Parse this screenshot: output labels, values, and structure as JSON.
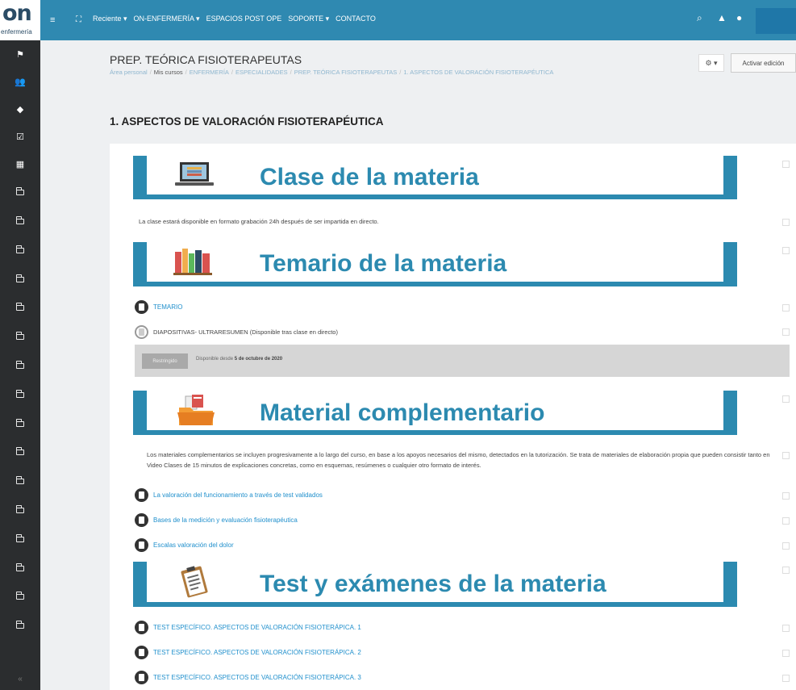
{
  "logo": {
    "text": "on",
    "subtext": "enfermería"
  },
  "topnav": {
    "items": [
      "Reciente ▾",
      "ON-ENFERMERÍA ▾",
      "ESPACIOS POST OPE",
      "SOPORTE ▾",
      "CONTACTO"
    ]
  },
  "header": {
    "course_title": "PREP. TEÓRICA FISIOTERAPEUTAS",
    "breadcrumb": [
      "Área personal",
      "Mis cursos",
      "ENFERMERÍA",
      "ESPECIALIDADES",
      "PREP. TEÓRICA FISIOTERAPEUTAS",
      "1. ASPECTOS DE VALORACIÓN FISIOTERAPÉUTICA"
    ],
    "edit_button": "Activar edición",
    "gear_label": "⚙ ▾"
  },
  "section": {
    "title": "1. ASPECTOS DE VALORACIÓN FISIOTERAPÉUTICA"
  },
  "banners": {
    "clase": "Clase de la materia",
    "temario": "Temario de la materia",
    "material": "Material complementario",
    "test": "Test y exámenes de la materia"
  },
  "clase_note": "La clase estará disponible en formato grabación 24h después de ser impartida en directo.",
  "temario_items": {
    "temario": "TEMARIO",
    "diapositivas": "DIAPOSITIVAS- ULTRARESUMEN (Disponible tras clase en directo)"
  },
  "restriction": {
    "badge": "Restringido",
    "text_prefix": "Disponible desde ",
    "date": "5 de octubre de 2020"
  },
  "material_note": "Los materiales complementarios se incluyen progresivamente a lo largo del curso, en base a los apoyos necesarios del mismo, detectados en la tutorización. Se trata de materiales de elaboración propia que pueden consistir tanto en Video Clases de 15 minutos de explicaciones concretas, como en esquemas, resúmenes o cualquier otro formato de interés.",
  "material_items": [
    "La valoración del funcionamiento a través de test validados",
    "Bases de la medición y evaluación fisioterapéutica",
    "Escalas valoración del dolor"
  ],
  "test_items": [
    "TEST ESPECÍFICO. ASPECTOS DE VALORACIÓN FISIOTERÁPICA. 1",
    "TEST ESPECÍFICO. ASPECTOS DE VALORACIÓN FISIOTERÁPICA. 2",
    "TEST ESPECÍFICO. ASPECTOS DE VALORACIÓN FISIOTERÁPICA. 3"
  ],
  "colors": {
    "topbar": "#2f89b1",
    "sidebar": "#2b2d2f",
    "banner": "#2c8ab0",
    "link": "#1f8fcc"
  }
}
